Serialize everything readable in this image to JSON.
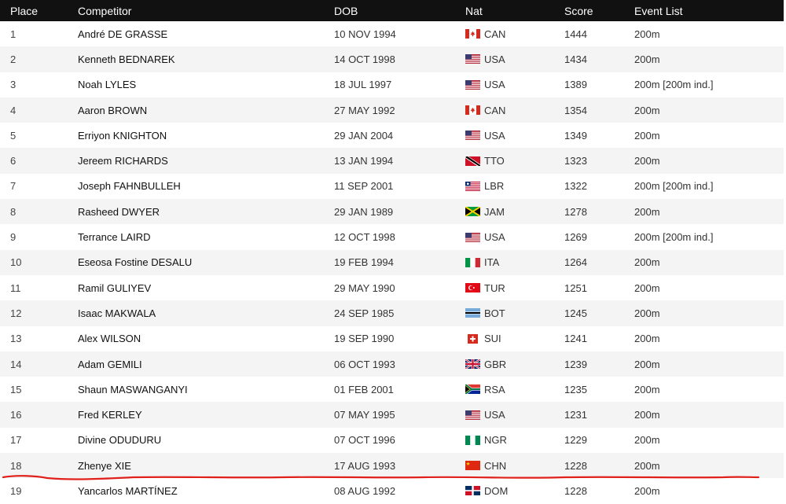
{
  "header": {
    "place": "Place",
    "competitor": "Competitor",
    "dob": "DOB",
    "nat": "Nat",
    "score": "Score",
    "events": "Event List"
  },
  "rows": [
    {
      "place": "1",
      "name": "André DE GRASSE",
      "dob": "10 NOV 1994",
      "nat": "CAN",
      "flag": "can",
      "score": "1444",
      "events": "200m"
    },
    {
      "place": "2",
      "name": "Kenneth BEDNAREK",
      "dob": "14 OCT 1998",
      "nat": "USA",
      "flag": "usa",
      "score": "1434",
      "events": "200m"
    },
    {
      "place": "3",
      "name": "Noah LYLES",
      "dob": "18 JUL 1997",
      "nat": "USA",
      "flag": "usa",
      "score": "1389",
      "events": "200m [200m ind.]"
    },
    {
      "place": "4",
      "name": "Aaron BROWN",
      "dob": "27 MAY 1992",
      "nat": "CAN",
      "flag": "can",
      "score": "1354",
      "events": "200m"
    },
    {
      "place": "5",
      "name": "Erriyon KNIGHTON",
      "dob": "29 JAN 2004",
      "nat": "USA",
      "flag": "usa",
      "score": "1349",
      "events": "200m"
    },
    {
      "place": "6",
      "name": "Jereem RICHARDS",
      "dob": "13 JAN 1994",
      "nat": "TTO",
      "flag": "tto",
      "score": "1323",
      "events": "200m"
    },
    {
      "place": "7",
      "name": "Joseph FAHNBULLEH",
      "dob": "11 SEP 2001",
      "nat": "LBR",
      "flag": "lbr",
      "score": "1322",
      "events": "200m [200m ind.]"
    },
    {
      "place": "8",
      "name": "Rasheed DWYER",
      "dob": "29 JAN 1989",
      "nat": "JAM",
      "flag": "jam",
      "score": "1278",
      "events": "200m"
    },
    {
      "place": "9",
      "name": "Terrance LAIRD",
      "dob": "12 OCT 1998",
      "nat": "USA",
      "flag": "usa",
      "score": "1269",
      "events": "200m [200m ind.]"
    },
    {
      "place": "10",
      "name": "Eseosa Fostine DESALU",
      "dob": "19 FEB 1994",
      "nat": "ITA",
      "flag": "ita",
      "score": "1264",
      "events": "200m"
    },
    {
      "place": "11",
      "name": "Ramil GULIYEV",
      "dob": "29 MAY 1990",
      "nat": "TUR",
      "flag": "tur",
      "score": "1251",
      "events": "200m"
    },
    {
      "place": "12",
      "name": "Isaac MAKWALA",
      "dob": "24 SEP 1985",
      "nat": "BOT",
      "flag": "bot",
      "score": "1245",
      "events": "200m"
    },
    {
      "place": "13",
      "name": "Alex WILSON",
      "dob": "19 SEP 1990",
      "nat": "SUI",
      "flag": "sui",
      "score": "1241",
      "events": "200m"
    },
    {
      "place": "14",
      "name": "Adam GEMILI",
      "dob": "06 OCT 1993",
      "nat": "GBR",
      "flag": "gbr",
      "score": "1239",
      "events": "200m"
    },
    {
      "place": "15",
      "name": "Shaun MASWANGANYI",
      "dob": "01 FEB 2001",
      "nat": "RSA",
      "flag": "rsa",
      "score": "1235",
      "events": "200m"
    },
    {
      "place": "16",
      "name": "Fred KERLEY",
      "dob": "07 MAY 1995",
      "nat": "USA",
      "flag": "usa",
      "score": "1231",
      "events": "200m"
    },
    {
      "place": "17",
      "name": "Divine ODUDURU",
      "dob": "07 OCT 1996",
      "nat": "NGR",
      "flag": "ngr",
      "score": "1229",
      "events": "200m"
    },
    {
      "place": "18",
      "name": "Zhenye XIE",
      "dob": "17 AUG 1993",
      "nat": "CHN",
      "flag": "chn",
      "score": "1228",
      "events": "200m"
    },
    {
      "place": "19",
      "name": "Yancarlos MARTÍNEZ",
      "dob": "08 AUG 1992",
      "nat": "DOM",
      "flag": "dom",
      "score": "1228",
      "events": "200m"
    }
  ],
  "annotation_color": "#e0201b"
}
